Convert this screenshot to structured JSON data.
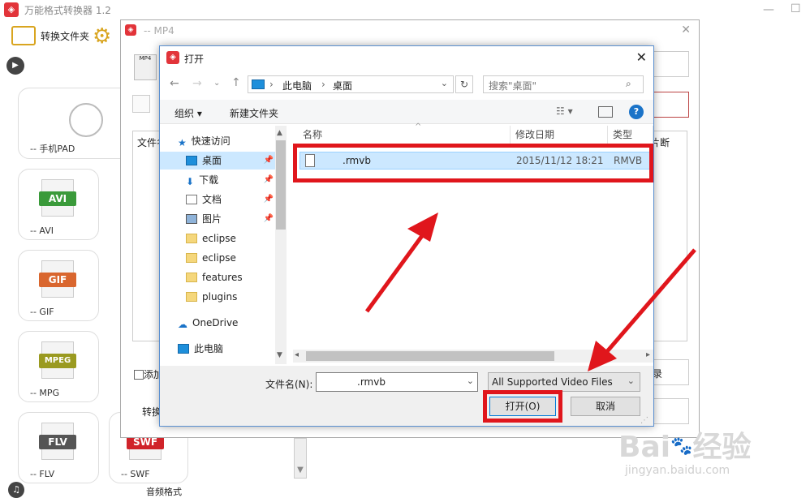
{
  "app": {
    "title": "万能格式转换器 1.2",
    "logo": "◈",
    "convert_folder": "转换文件夹",
    "bottom_label": "音频格式",
    "cards": [
      {
        "label": "-- 手机PAD",
        "icon": "apple-icon"
      },
      {
        "label": "-- AVI",
        "badge": "AVI",
        "color": "#3a9a3a"
      },
      {
        "label": "-- GIF",
        "badge": "GIF",
        "color": "#d9662e"
      },
      {
        "label": "-- MPG",
        "badge": "MPEG",
        "color": "#9a9a20"
      },
      {
        "label": "-- FLV",
        "badge": "FLV",
        "color": "#555555"
      },
      {
        "label": "-- SWF",
        "badge": "SWF",
        "color": "#d0232a"
      }
    ]
  },
  "mp4_dialog": {
    "title": "-- MP4",
    "file_label": "文件名",
    "add_label": "添加",
    "convert_label": "转换",
    "fragment_label": "片断",
    "checkbox_right": "录"
  },
  "open_dialog": {
    "title": "打开",
    "breadcrumb": [
      "此电脑",
      "桌面"
    ],
    "search_placeholder": "搜索\"桌面\"",
    "organize": "组织",
    "new_folder": "新建文件夹",
    "sidebar": [
      {
        "label": "快速访问",
        "icon": "star-icon"
      },
      {
        "label": "桌面",
        "icon": "desktop-icon",
        "pinned": true
      },
      {
        "label": "下载",
        "icon": "download-icon",
        "pinned": true
      },
      {
        "label": "文档",
        "icon": "document-icon",
        "pinned": true
      },
      {
        "label": "图片",
        "icon": "picture-icon",
        "pinned": true
      },
      {
        "label": "eclipse",
        "icon": "folder-icon"
      },
      {
        "label": "eclipse",
        "icon": "folder-icon"
      },
      {
        "label": "features",
        "icon": "folder-icon"
      },
      {
        "label": "plugins",
        "icon": "folder-icon"
      },
      {
        "label": "OneDrive",
        "icon": "cloud-icon"
      },
      {
        "label": "此电脑",
        "icon": "computer-icon"
      }
    ],
    "columns": [
      "名称",
      "修改日期",
      "类型"
    ],
    "files": [
      {
        "name": ".rmvb",
        "date": "2015/11/12 18:21",
        "type": "RMVB"
      }
    ],
    "filename_label": "文件名(N):",
    "filename_value": ".rmvb",
    "filter_value": "All Supported Video Files",
    "open_button": "打开(O)",
    "cancel_button": "取消"
  },
  "watermark": {
    "brand": "Bai",
    "brand2": "经验",
    "url": "jingyan.baidu.com"
  },
  "colors": {
    "highlight": "#e0161c",
    "selection": "#cce8ff",
    "accent": "#1a73c8"
  }
}
